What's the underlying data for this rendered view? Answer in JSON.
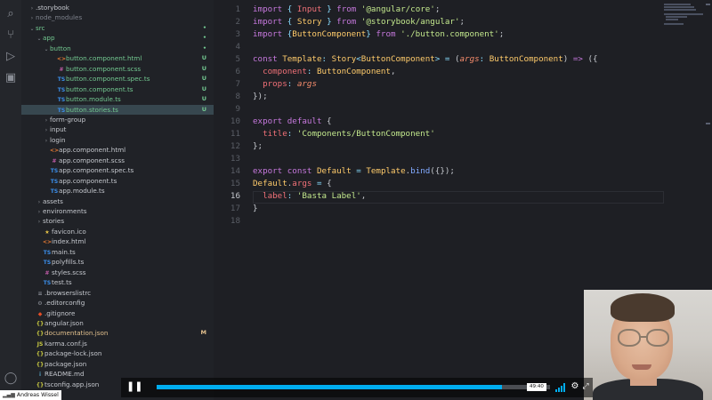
{
  "explorer": {
    "items": [
      {
        "label": ".storybook",
        "chev": ">",
        "icon": "",
        "badge": "",
        "tone": "plain"
      },
      {
        "label": "node_modules",
        "chev": ">",
        "icon": "",
        "badge": "",
        "tone": "dim"
      },
      {
        "label": "src",
        "chev": "v",
        "icon": "",
        "badge": "",
        "tone": "green"
      },
      {
        "label": "app",
        "chev": "v",
        "icon": "",
        "badge": "",
        "tone": "green"
      },
      {
        "label": "button",
        "chev": "v",
        "icon": "",
        "badge": "",
        "tone": "green"
      },
      {
        "label": "button.component.html",
        "chev": "",
        "icon": "<>",
        "badge": "U",
        "tone": "green"
      },
      {
        "label": "button.component.scss",
        "chev": "",
        "icon": "#",
        "badge": "U",
        "tone": "green"
      },
      {
        "label": "button.component.spec.ts",
        "chev": "",
        "icon": "TS",
        "badge": "U",
        "tone": "green"
      },
      {
        "label": "button.component.ts",
        "chev": "",
        "icon": "TS",
        "badge": "U",
        "tone": "green"
      },
      {
        "label": "button.module.ts",
        "chev": "",
        "icon": "TS",
        "badge": "U",
        "tone": "green"
      },
      {
        "label": "button.stories.ts",
        "chev": "",
        "icon": "TS",
        "badge": "U",
        "tone": "green"
      },
      {
        "label": "form-group",
        "chev": ">",
        "icon": "",
        "badge": "",
        "tone": "plain"
      },
      {
        "label": "input",
        "chev": ">",
        "icon": "",
        "badge": "",
        "tone": "plain"
      },
      {
        "label": "login",
        "chev": ">",
        "icon": "",
        "badge": "",
        "tone": "plain"
      },
      {
        "label": "app.component.html",
        "chev": "",
        "icon": "<>",
        "badge": "",
        "tone": "plain"
      },
      {
        "label": "app.component.scss",
        "chev": "",
        "icon": "#",
        "badge": "",
        "tone": "plain"
      },
      {
        "label": "app.component.spec.ts",
        "chev": "",
        "icon": "TS",
        "badge": "",
        "tone": "plain"
      },
      {
        "label": "app.component.ts",
        "chev": "",
        "icon": "TS",
        "badge": "",
        "tone": "plain"
      },
      {
        "label": "app.module.ts",
        "chev": "",
        "icon": "TS",
        "badge": "",
        "tone": "plain"
      },
      {
        "label": "assets",
        "chev": ">",
        "icon": "",
        "badge": "",
        "tone": "plain"
      },
      {
        "label": "environments",
        "chev": ">",
        "icon": "",
        "badge": "",
        "tone": "plain"
      },
      {
        "label": "stories",
        "chev": ">",
        "icon": "",
        "badge": "",
        "tone": "plain"
      },
      {
        "label": "favicon.ico",
        "chev": "",
        "icon": "★",
        "badge": "",
        "tone": "plain"
      },
      {
        "label": "index.html",
        "chev": "",
        "icon": "<>",
        "badge": "",
        "tone": "plain"
      },
      {
        "label": "main.ts",
        "chev": "",
        "icon": "TS",
        "badge": "",
        "tone": "plain"
      },
      {
        "label": "polyfills.ts",
        "chev": "",
        "icon": "TS",
        "badge": "",
        "tone": "plain"
      },
      {
        "label": "styles.scss",
        "chev": "",
        "icon": "#",
        "badge": "",
        "tone": "plain"
      },
      {
        "label": "test.ts",
        "chev": "",
        "icon": "TS",
        "badge": "",
        "tone": "plain"
      },
      {
        "label": ".browserslistrc",
        "chev": "",
        "icon": "≡",
        "badge": "",
        "tone": "plain"
      },
      {
        "label": ".editorconfig",
        "chev": "",
        "icon": "⚙",
        "badge": "",
        "tone": "plain"
      },
      {
        "label": ".gitignore",
        "chev": "",
        "icon": "◆",
        "badge": "",
        "tone": "plain"
      },
      {
        "label": "angular.json",
        "chev": "",
        "icon": "{}",
        "badge": "",
        "tone": "plain"
      },
      {
        "label": "documentation.json",
        "chev": "",
        "icon": "{}",
        "badge": "M",
        "tone": "yellow"
      },
      {
        "label": "karma.conf.js",
        "chev": "",
        "icon": "JS",
        "badge": "",
        "tone": "plain"
      },
      {
        "label": "package-lock.json",
        "chev": "",
        "icon": "{}",
        "badge": "",
        "tone": "plain"
      },
      {
        "label": "package.json",
        "chev": "",
        "icon": "{}",
        "badge": "",
        "tone": "plain"
      },
      {
        "label": "README.md",
        "chev": "",
        "icon": "i",
        "badge": "",
        "tone": "plain"
      },
      {
        "label": "tsconfig.app.json",
        "chev": "",
        "icon": "{}",
        "badge": "",
        "tone": "plain"
      }
    ]
  },
  "editor": {
    "line_numbers": [
      "1",
      "2",
      "3",
      "4",
      "5",
      "6",
      "7",
      "8",
      "9",
      "10",
      "11",
      "12",
      "13",
      "14",
      "15",
      "16",
      "17",
      "18"
    ],
    "active_line": "16"
  },
  "player": {
    "time": "49:40",
    "progress": 0.877
  },
  "credit": {
    "name": "Andreas Wissel"
  },
  "icons": {
    "play": "pause-icon",
    "settings": "gear-icon",
    "fullscreen": "fullscreen-icon"
  },
  "colors": {
    "accent": "#00adef",
    "git_untracked": "#73c991",
    "git_modified": "#e2c08d"
  }
}
